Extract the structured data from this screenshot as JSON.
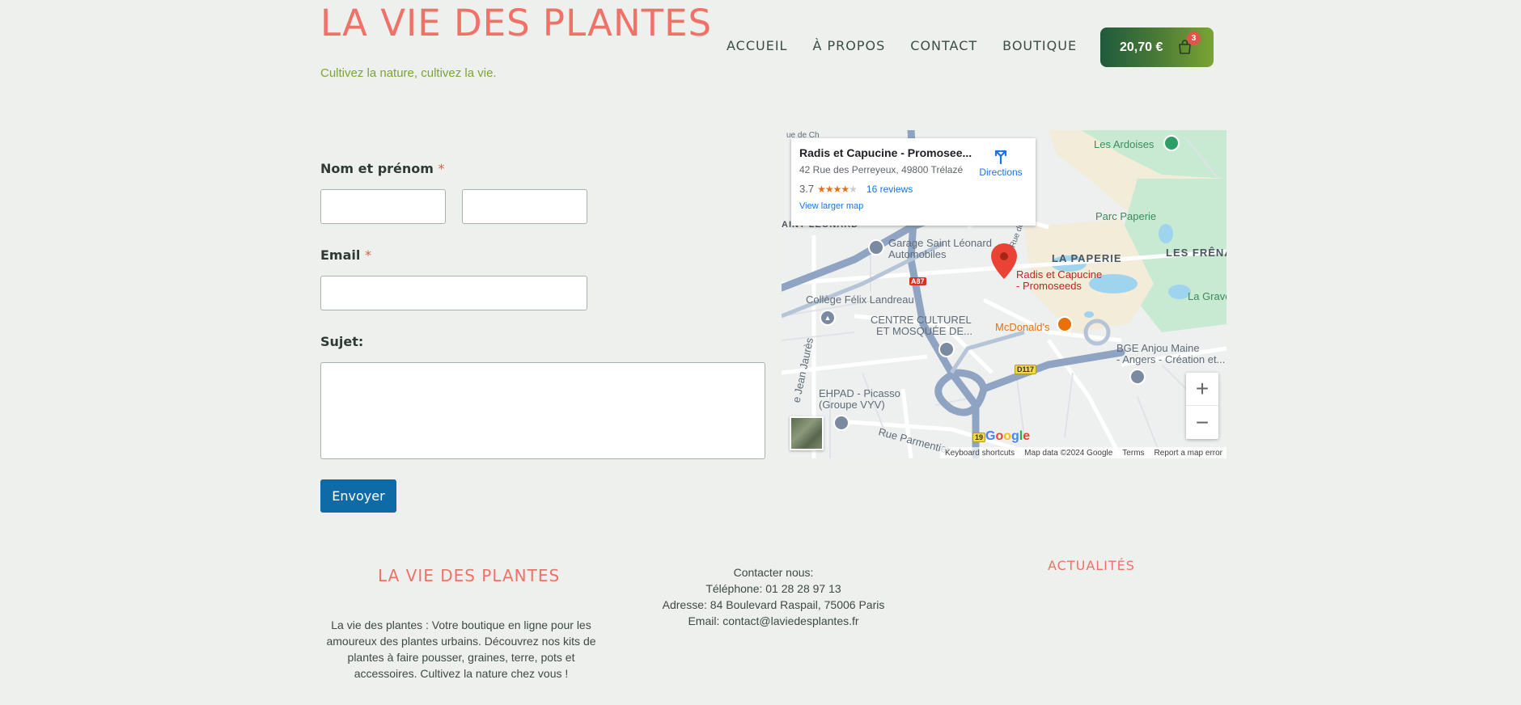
{
  "header": {
    "site_title": "LA VIE DES PLANTES",
    "tagline": "Cultivez la nature, cultivez la vie.",
    "nav": [
      "ACCUEIL",
      "À PROPOS",
      "CONTACT",
      "BOUTIQUE"
    ],
    "cart": {
      "total": "20,70 €",
      "count": "3",
      "icon": "shopping-bag-icon"
    }
  },
  "form": {
    "name_label": "Nom et prénom",
    "email_label": "Email",
    "subject_label": "Sujet:",
    "required_mark": "*",
    "submit_label": "Envoyer"
  },
  "map": {
    "card": {
      "title": "Radis et Capucine - Promosee...",
      "address": "42 Rue des Perreyeux, 49800 Trélazé",
      "rating": "3.7",
      "stars_filled": 3.5,
      "reviews": "16 reviews",
      "view_larger": "View larger map",
      "directions": "Directions"
    },
    "labels": {
      "les_ardoises": "Les Ardoises",
      "parc_paperie": "Parc Paperie",
      "la_paperie": "LA PAPERIE",
      "les_frenaies": "LES FRÊNAIES",
      "la_grave": "La Grave",
      "saint_leonard": "AINT-LÉONARD",
      "garage_1": "Garage Saint Léonard",
      "garage_2": "Automobiles",
      "college": "Collège Félix Landreau",
      "centre_1": "CENTRE CULTUREL",
      "centre_2": "ET MOSQUÉE DE...",
      "radis_1": "Radis et Capucine",
      "radis_2": "- Promoseeds",
      "mcdonalds": "McDonald's",
      "bge_1": "BGE Anjou Maine",
      "bge_2": "- Angers - Création et...",
      "ehpad_1": "EHPAD - Picasso",
      "ehpad_2": "(Groupe VYV)",
      "rue_parmentier": "Rue Parmentier",
      "rue_jean_jaures": "e Jean Jaurès",
      "rue_de_la": "Rue de la",
      "rue_de_ch": "ue de Ch",
      "a87": "A87",
      "d117": "D117",
      "r19": "19"
    },
    "zoom_in": "+",
    "zoom_out": "−",
    "google": "Google",
    "footer": [
      "Keyboard shortcuts",
      "Map data ©2024 Google",
      "Terms",
      "Report a map error"
    ]
  },
  "footer": {
    "about_title": "LA VIE DES PLANTES",
    "about_lines": [
      "La vie des plantes : Votre boutique en ligne pour les",
      "amoureux des plantes urbains. Découvrez nos kits de",
      "plantes à faire pousser, graines, terre, pots et",
      "accessoires. Cultivez la nature chez vous !"
    ],
    "contact_lines": [
      "Contacter nous:",
      "Téléphone: 01 28 28 97 13",
      "Adresse: 84 Boulevard Raspail, 75006 Paris",
      "Email: contact@laviedesplantes.fr"
    ],
    "news_title": "ACTUALITÉS"
  }
}
